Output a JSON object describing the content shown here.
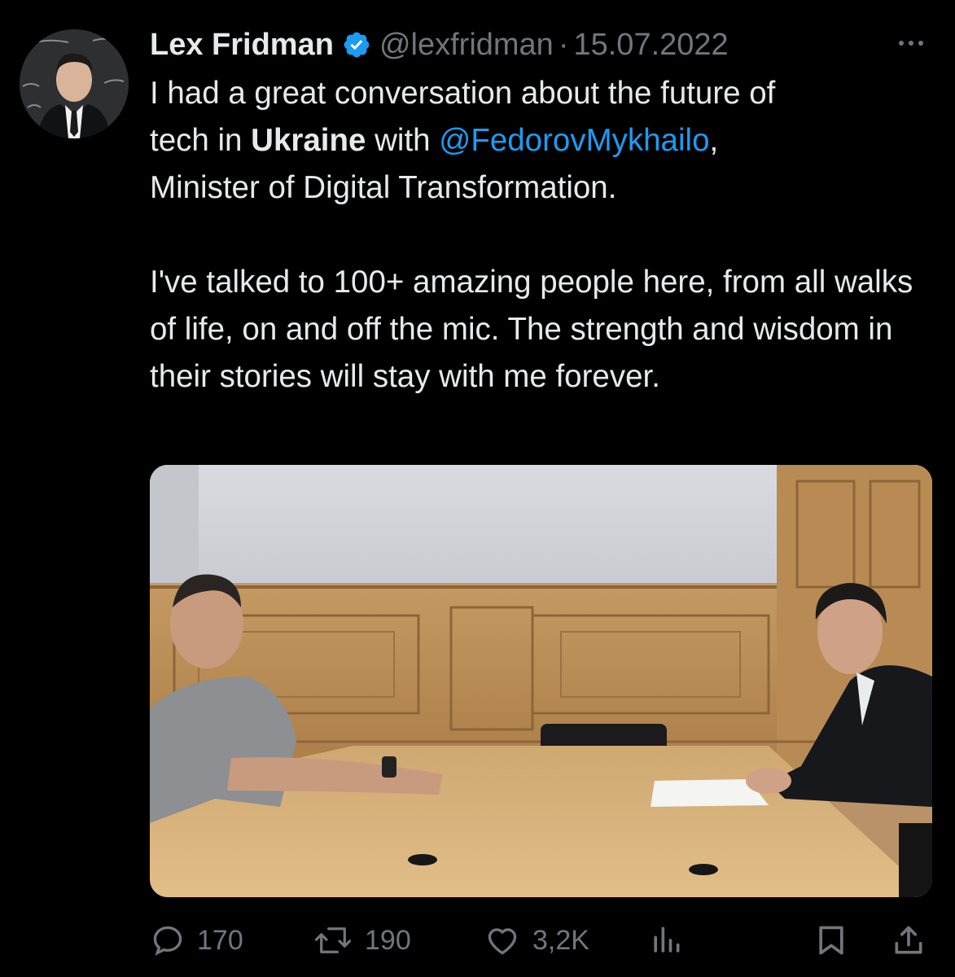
{
  "tweet": {
    "author_name": "Lex Fridman",
    "handle": "@lexfridman",
    "separator": "·",
    "date": "15.07.2022",
    "text": {
      "line1_a": "I had a great conversation about the future of",
      "line1_b": "tech in ",
      "bold_word": "Ukraine",
      "line1_c": " with ",
      "mention": "@FedorovMykhailo",
      "line1_d": ",",
      "line1_e": "Minister of Digital Transformation.",
      "paragraph2": "I've talked to 100+ amazing people here, from all walks of life, on and off the mic. The strength and wisdom in their stories will stay with me forever."
    }
  },
  "actions": {
    "replies": "170",
    "retweets": "190",
    "likes": "3,2K"
  },
  "icons": {
    "verified": "verified-badge-icon",
    "more": "more-options-icon",
    "reply": "reply-icon",
    "retweet": "retweet-icon",
    "like": "heart-icon",
    "views": "analytics-icon",
    "bookmark": "bookmark-icon",
    "share": "share-icon"
  },
  "colors": {
    "background": "#000000",
    "text": "#e7e9ea",
    "secondary": "#71767b",
    "link": "#1d9bf0"
  }
}
